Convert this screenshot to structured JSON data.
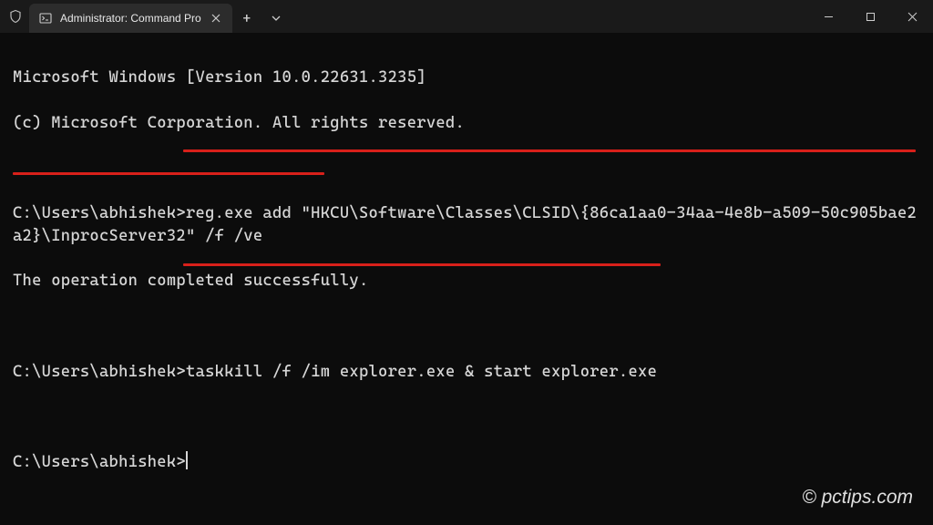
{
  "titlebar": {
    "tab_title": "Administrator: Command Pro",
    "new_tab_label": "+",
    "dropdown_label": "⌄"
  },
  "terminal": {
    "banner1": "Microsoft Windows [Version 10.0.22631.3235]",
    "banner2": "(c) Microsoft Corporation. All rights reserved.",
    "prompt": "C:\\Users\\abhishek>",
    "cmd1": "reg.exe add \"HKCU\\Software\\Classes\\CLSID\\{86ca1aa0-34aa-4e8b-a509-50c905bae2a2}\\InprocServer32\" /f /ve",
    "result1": "The operation completed successfully.",
    "cmd2": "taskkill /f /im explorer.exe & start explorer.exe"
  },
  "watermark": "© pctips.com",
  "annotations": {
    "underline_color": "#d8201a"
  }
}
